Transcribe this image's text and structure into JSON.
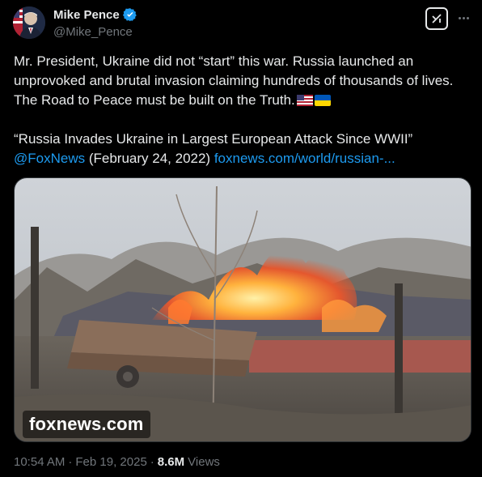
{
  "author": {
    "name": "Mike Pence",
    "handle": "@Mike_Pence",
    "verified": true
  },
  "icons": {
    "verified": "verified-badge-icon",
    "grok": "grok-icon",
    "more": "more-icon"
  },
  "post": {
    "line1": "Mr. President, Ukraine did not “start” this war. Russia launched an",
    "line2": "unprovoked and brutal invasion claiming hundreds of thousands of lives.",
    "line3": "The Road to Peace must be built on the Truth.",
    "quote": "“Russia Invades Ukraine in Largest European Attack Since WWII”",
    "mention": "@FoxNews",
    "date_text": "(February 24, 2022)",
    "link": "foxnews.com/world/russian-..."
  },
  "media": {
    "watermark": "foxnews.com"
  },
  "meta": {
    "time": "10:54 AM",
    "separator1": "·",
    "date": "Feb 19, 2025",
    "separator2": "·",
    "views": "8.6M",
    "views_label": "Views"
  },
  "colors": {
    "background": "#000000",
    "text": "#e7e9ea",
    "secondary": "#71767b",
    "link": "#1d9bf0"
  }
}
